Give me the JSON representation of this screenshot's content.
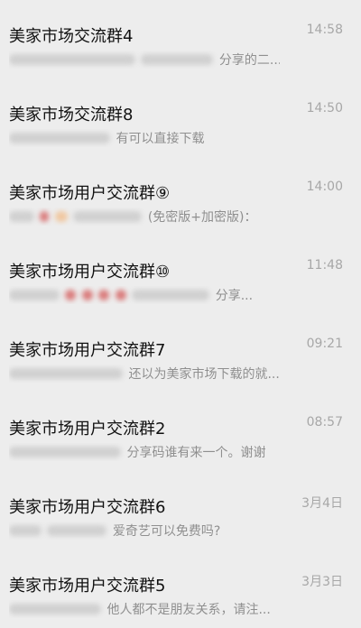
{
  "chats": [
    {
      "title": "美家市场交流群4",
      "time": "14:58",
      "preview": "分享的二..."
    },
    {
      "title": "美家市场交流群8",
      "time": "14:50",
      "preview": "有可以直接下载"
    },
    {
      "title": "美家市场用户交流群⑨",
      "time": "14:00",
      "preview": "(免密版+加密版)："
    },
    {
      "title": "美家市场用户交流群⑩",
      "time": "11:48",
      "preview": "分享..."
    },
    {
      "title": "美家市场用户交流群7",
      "time": "09:21",
      "preview": "还以为美家市场下载的就..."
    },
    {
      "title": "美家市场用户交流群2",
      "time": "08:57",
      "preview": "分享码谁有来一个。谢谢"
    },
    {
      "title": "美家市场用户交流群6",
      "time": "3月4日",
      "preview": "爱奇艺可以免费吗?"
    },
    {
      "title": "美家市场用户交流群5",
      "time": "3月3日",
      "preview": "他人都不是朋友关系，请注..."
    }
  ]
}
